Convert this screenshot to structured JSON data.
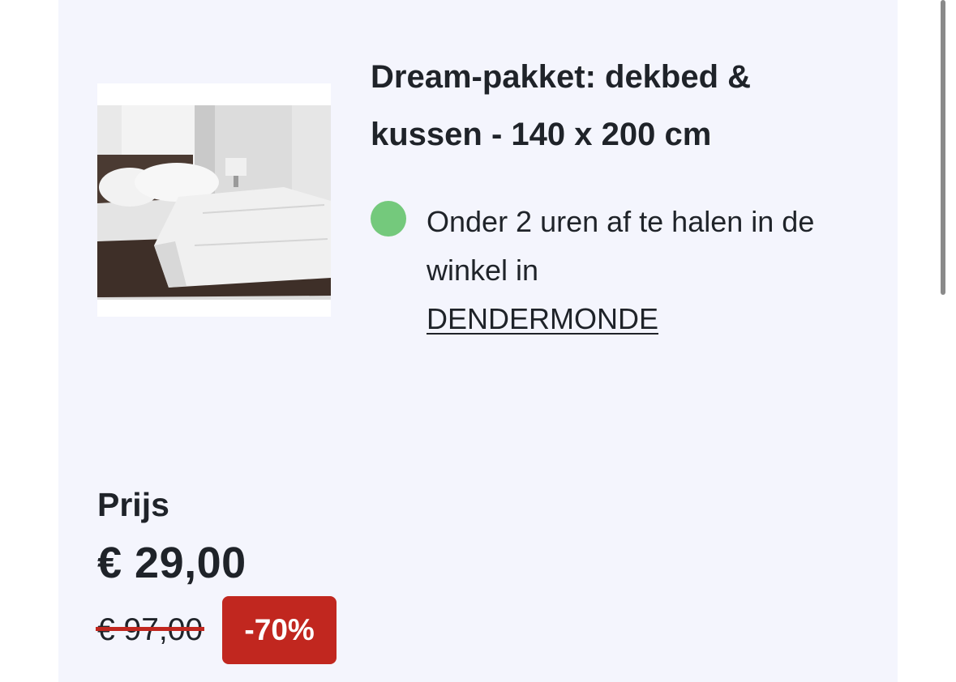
{
  "product": {
    "title": "Dream-pakket: dekbed & kussen - 140 x 200 cm",
    "image_icon": "bed-photo",
    "availability": {
      "status_color": "#74c97c",
      "text": "Onder 2 uren af te halen in de winkel in",
      "store": "DENDERMONDE"
    }
  },
  "pricing": {
    "label": "Prijs",
    "current": "€ 29,00",
    "original": "€ 97,00",
    "discount": "-70%",
    "discount_color": "#c1271f"
  },
  "colors": {
    "card_background": "#f4f5fd",
    "text": "#1f2329"
  }
}
